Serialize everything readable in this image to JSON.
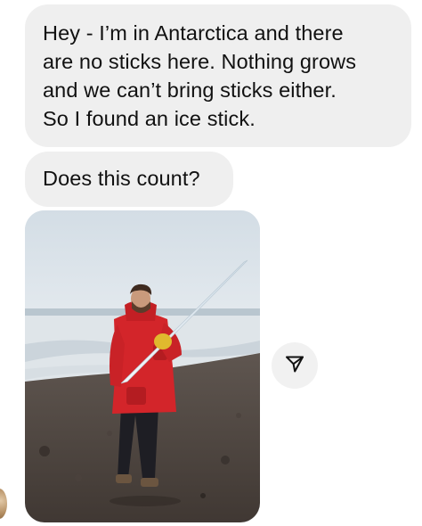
{
  "conversation": {
    "messages": [
      {
        "type": "text",
        "text": "Hey - I’m in Antarctica and there\nare no sticks here. Nothing grows\nand we can’t bring sticks either.\nSo I found an ice stick."
      },
      {
        "type": "text",
        "text": "Does this count?"
      },
      {
        "type": "image"
      }
    ],
    "share_icon": "paper-plane-icon"
  }
}
